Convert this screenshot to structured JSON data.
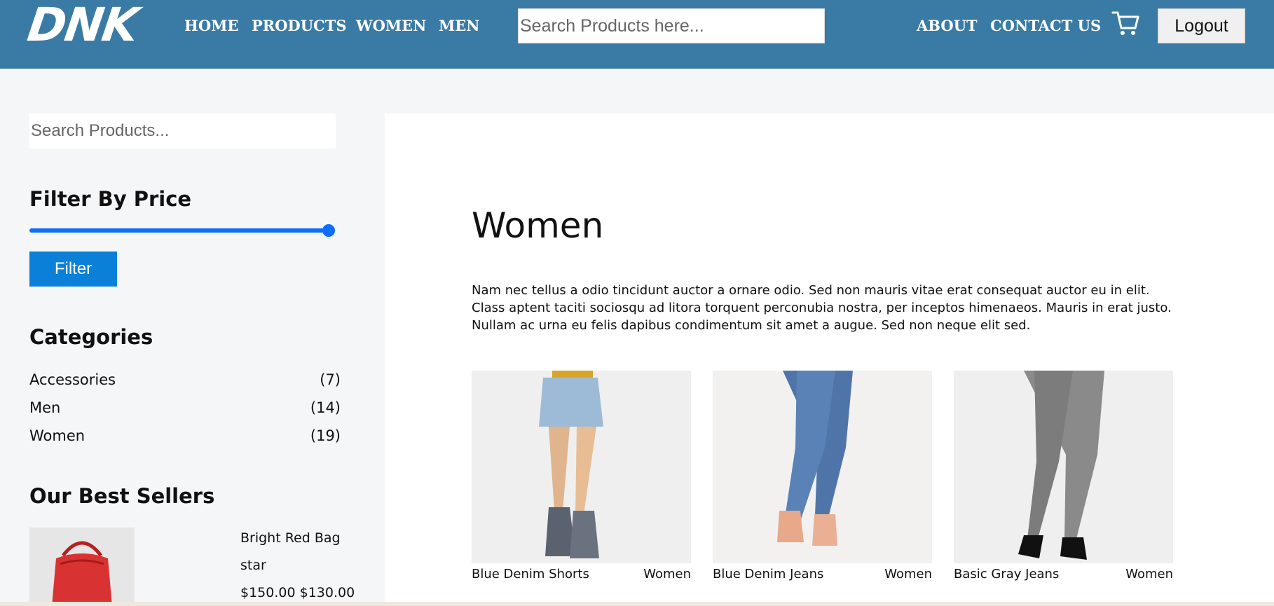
{
  "header": {
    "logo_text": "DNK",
    "nav_left": [
      "HOME",
      "PRODUCTS",
      "WOMEN",
      "MEN"
    ],
    "search_placeholder": "Search Products here...",
    "nav_right": [
      "ABOUT",
      "CONTACT US"
    ],
    "cart_icon": "cart-icon",
    "logout_label": "Logout",
    "bg_color": "#3a7ba5"
  },
  "sidebar": {
    "search_placeholder": "Search Products...",
    "filter_heading": "Filter By Price",
    "price_slider_level": 1.0,
    "filter_button": "Filter",
    "categories_heading": "Categories",
    "categories": [
      {
        "name": "Accessories",
        "count": "(7)"
      },
      {
        "name": "Men",
        "count": "(14)"
      },
      {
        "name": "Women",
        "count": "(19)"
      }
    ],
    "best_sellers_heading": "Our Best Sellers",
    "best_seller": {
      "name": "Bright Red Bag",
      "rating": "star",
      "price": "$150.00 $130.00"
    },
    "accent_color": "#0d6efd"
  },
  "main": {
    "title": "Women",
    "description": "Nam nec tellus a odio tincidunt auctor a ornare odio. Sed non mauris vitae erat consequat auctor eu in elit. Class aptent taciti sociosqu ad litora torquent perconubia nostra, per inceptos himenaeos. Mauris in erat justo. Nullam ac urna eu felis dapibus condimentum sit amet a augue. Sed non neque elit sed.",
    "products": [
      {
        "name": "Blue Denim Shorts",
        "category": "Women"
      },
      {
        "name": "Blue Denim Jeans",
        "category": "Women"
      },
      {
        "name": "Basic Gray Jeans",
        "category": "Women"
      }
    ]
  }
}
